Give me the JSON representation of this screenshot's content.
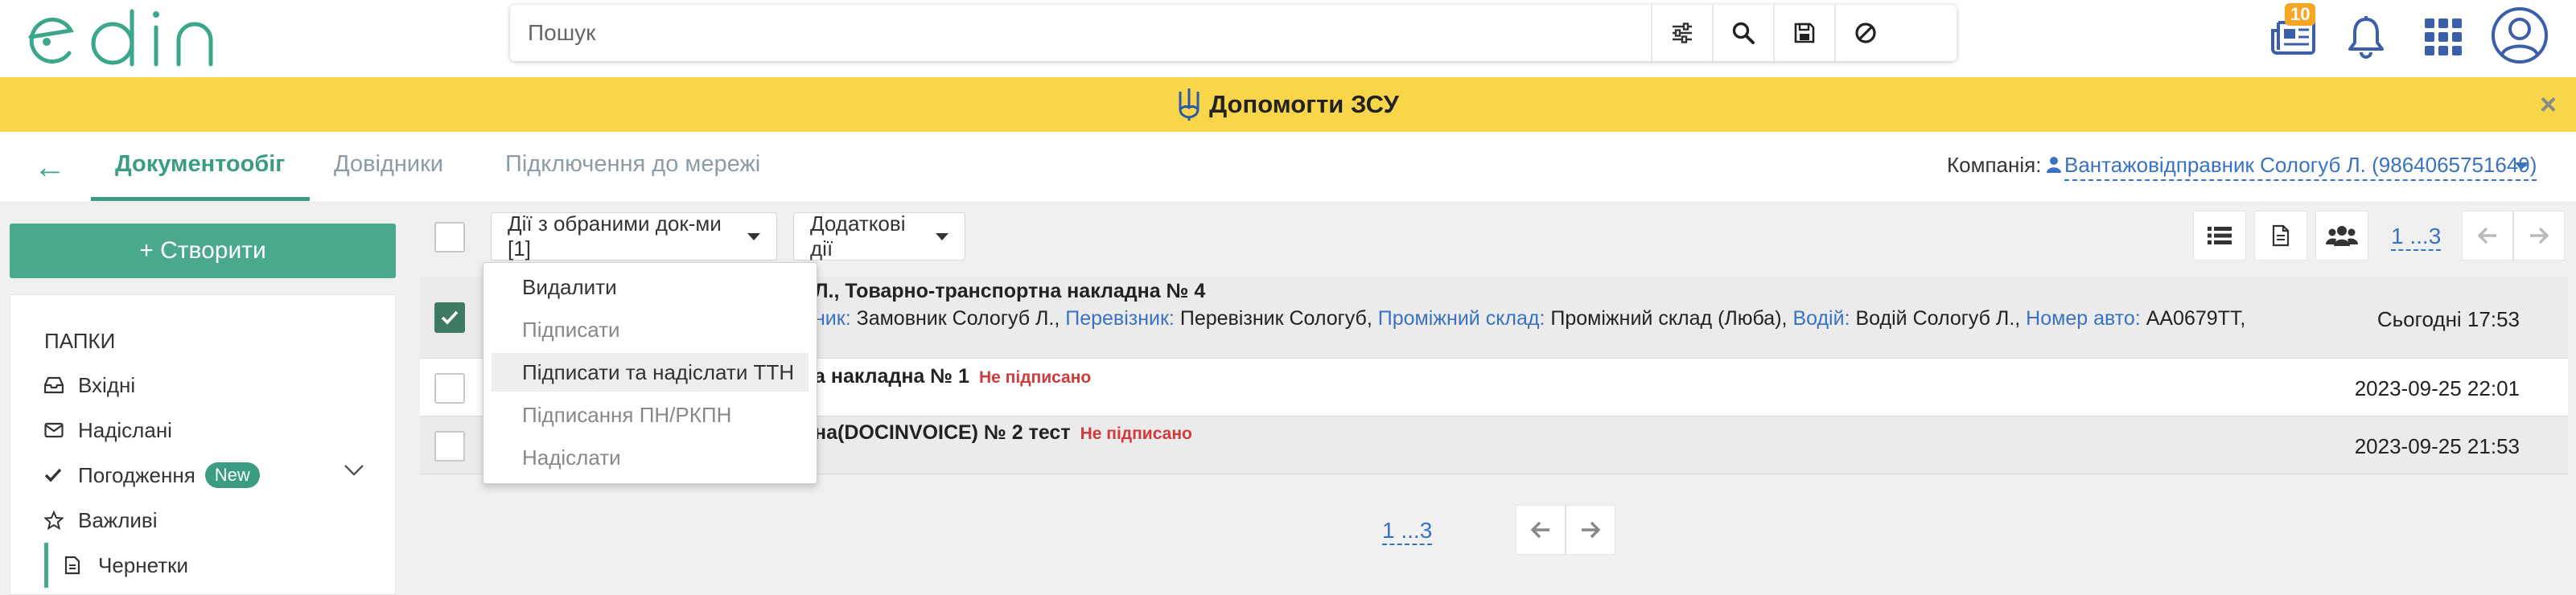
{
  "header": {
    "logo_text": "edin",
    "search_placeholder": "Пошук",
    "news_badge": "10",
    "colors": {
      "brand": "#3aa68b",
      "link": "#3a72c2",
      "danger": "#d03a3a"
    }
  },
  "banner": {
    "text": "Допомогти ЗСУ",
    "close_symbol": "×"
  },
  "nav": {
    "back_symbol": "←",
    "tabs": [
      {
        "label": "Документообіг",
        "active": true
      },
      {
        "label": "Довідники",
        "active": false
      },
      {
        "label": "Підключення до мережі",
        "active": false
      }
    ],
    "company_label": "Компанія:",
    "company_value": "Вантажовідправник Сологуб Л. (9864065751649)"
  },
  "sidebar": {
    "create_label": "+ Створити",
    "folders_title": "ПАПКИ",
    "folders": [
      {
        "label": "Вхідні",
        "icon": "inbox-icon"
      },
      {
        "label": "Надіслані",
        "icon": "envelope-icon"
      },
      {
        "label": "Погодження",
        "icon": "check-icon",
        "badge": "New"
      },
      {
        "label": "Важливі",
        "icon": "star-icon"
      },
      {
        "label": "Чернетки",
        "icon": "document-icon",
        "current": true
      }
    ]
  },
  "toolbar": {
    "actions_label": "Дії з обраними док-ми [1]",
    "extra_label": "Додаткові дії",
    "pager_label": "1 ...3"
  },
  "dropdown": {
    "items": [
      {
        "label": "Видалити",
        "enabled": true
      },
      {
        "label": "Підписати",
        "enabled": false
      },
      {
        "label": "Підписати та надіслати ТТН",
        "enabled": true,
        "highlighted": true
      },
      {
        "label": "Підписання ПН/РКПН",
        "enabled": false
      },
      {
        "label": "Надіслати",
        "enabled": false
      }
    ]
  },
  "documents": [
    {
      "title": "Л., Товарно-транспортна накладна № 4",
      "status": "",
      "checked": true,
      "date": "Сьогодні 17:53",
      "details": [
        {
          "key": "ник:",
          "value": "Замовник Сологуб Л.,"
        },
        {
          "key": "Перевізник:",
          "value": "Перевізник Сологуб,"
        },
        {
          "key": "Проміжний склад:",
          "value": "Проміжний склад (Люба),"
        },
        {
          "key": "Водій:",
          "value": "Водій Сологуб Л.,"
        },
        {
          "key": "Номер авто:",
          "value": "AA0679TT,"
        }
      ]
    },
    {
      "title": "а накладна № 1",
      "status": "Не підписано",
      "checked": false,
      "date": "2023-09-25 22:01"
    },
    {
      "title": "на(DOCINVOICE) № 2 тест",
      "status": "Не підписано",
      "checked": false,
      "date": "2023-09-25 21:53"
    }
  ],
  "bottom_pager": {
    "label": "1 ...3"
  }
}
